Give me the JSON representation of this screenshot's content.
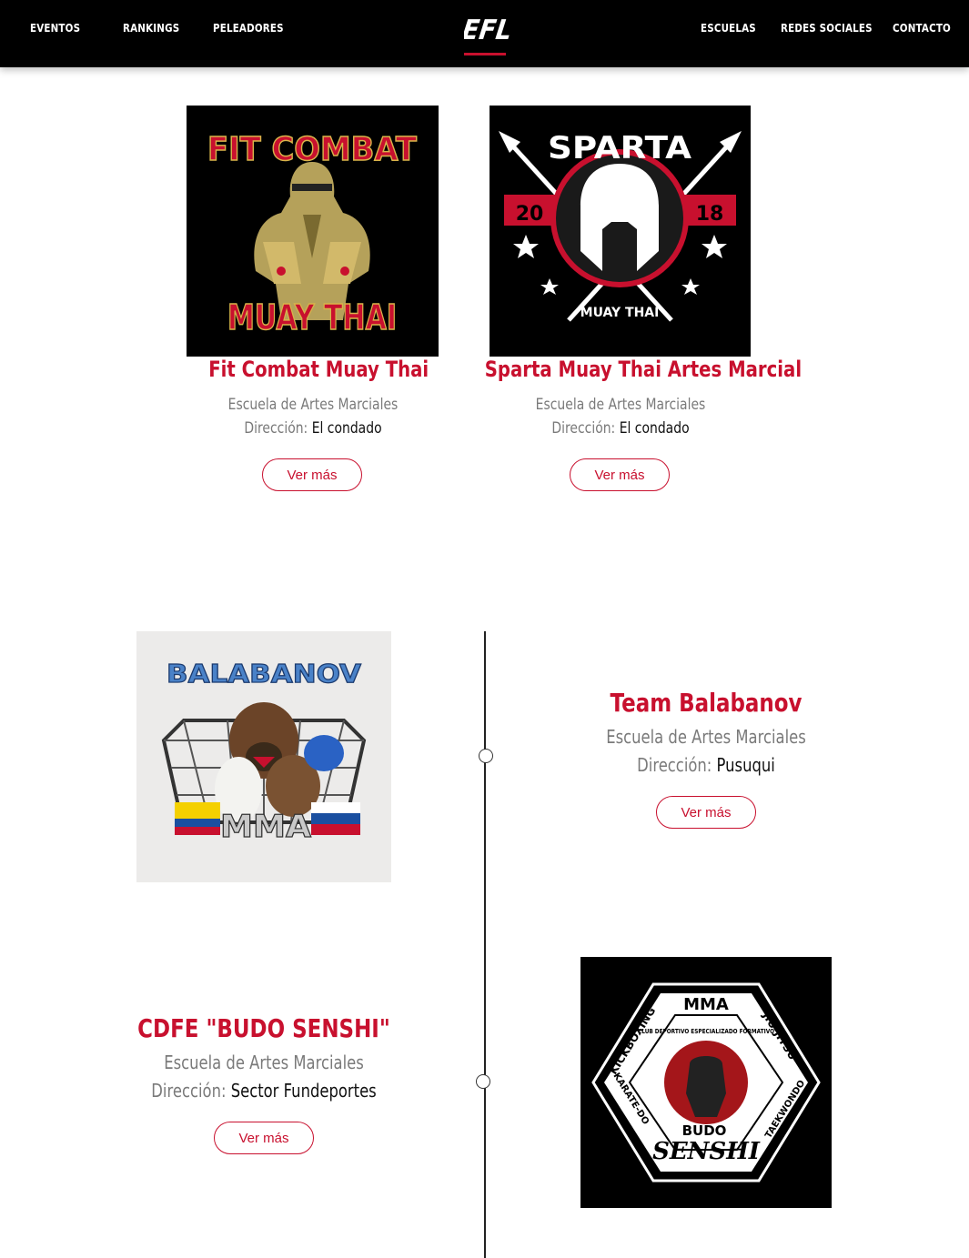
{
  "nav": {
    "left": [
      "EVENTOS",
      "RANKINGS",
      "PELEADORES"
    ],
    "logo": "EFL",
    "right": [
      "ESCUELAS",
      "REDES SOCIALES",
      "CONTACTO"
    ]
  },
  "schools": [
    {
      "name": "Fit Combat Muay Thai",
      "type": "Escuela de Artes Marciales",
      "address_label": "Dirección:",
      "address": "El condado",
      "button": "Ver más",
      "logo_text": [
        "FIT COMBAT",
        "MUAY THAI"
      ]
    },
    {
      "name": "Sparta Muay Thai Artes Marcial",
      "type": "Escuela de Artes Marciales",
      "address_label": "Dirección:",
      "address": "El condado",
      "button": "Ver más",
      "logo_text": [
        "SPARTA",
        "20",
        "18",
        "MUAY THAI"
      ]
    },
    {
      "name": "Team Balabanov",
      "type": "Escuela de Artes Marciales",
      "address_label": "Dirección:",
      "address": "Pusuqui",
      "button": "Ver más",
      "logo_text": [
        "BALABANOV",
        "MMA"
      ]
    },
    {
      "name": "CDFE \"BUDO SENSHI\"",
      "type": "Escuela de Artes Marciales",
      "address_label": "Dirección:",
      "address": "Sector Fundeportes",
      "button": "Ver más",
      "logo_text": [
        "MMA",
        "JIU-JITSU",
        "TAEKWONDO",
        "KARATE-DO",
        "KICKBOXING",
        "CLUB DEPORTIVO ESPECIALIZADO FORMATIVO",
        "BUDO",
        "SENSHI"
      ]
    }
  ],
  "colors": {
    "accent": "#c8102e",
    "nav_bg": "#000000",
    "muted_text": "#7a7a7a"
  }
}
